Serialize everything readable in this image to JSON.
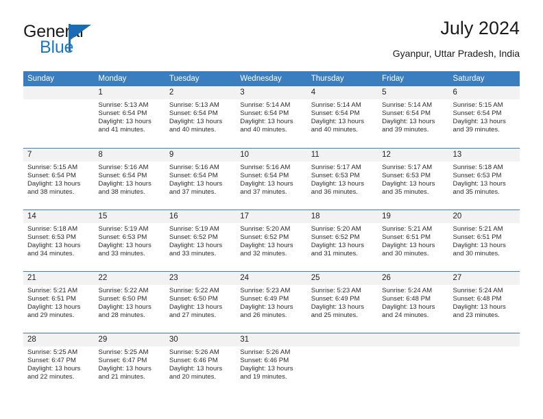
{
  "logo": {
    "word1": "General",
    "word2": "Blue",
    "accent_color": "#1c6cb5"
  },
  "header": {
    "title": "July 2024",
    "subtitle": "Gyanpur, Uttar Pradesh, India"
  },
  "theme": {
    "header_bar_color": "#3a7ebf",
    "daynum_bg": "#f2f2f2",
    "text_color": "#2b2b2b"
  },
  "weekdays": [
    "Sunday",
    "Monday",
    "Tuesday",
    "Wednesday",
    "Thursday",
    "Friday",
    "Saturday"
  ],
  "labels": {
    "sunrise_prefix": "Sunrise: ",
    "sunset_prefix": "Sunset: ",
    "daylight_prefix": "Daylight: "
  },
  "weeks": [
    [
      {
        "day": "",
        "sunrise": "",
        "sunset": "",
        "daylight_line1": "",
        "daylight_line2": ""
      },
      {
        "day": "1",
        "sunrise": "Sunrise: 5:13 AM",
        "sunset": "Sunset: 6:54 PM",
        "daylight_line1": "Daylight: 13 hours",
        "daylight_line2": "and 41 minutes."
      },
      {
        "day": "2",
        "sunrise": "Sunrise: 5:13 AM",
        "sunset": "Sunset: 6:54 PM",
        "daylight_line1": "Daylight: 13 hours",
        "daylight_line2": "and 40 minutes."
      },
      {
        "day": "3",
        "sunrise": "Sunrise: 5:14 AM",
        "sunset": "Sunset: 6:54 PM",
        "daylight_line1": "Daylight: 13 hours",
        "daylight_line2": "and 40 minutes."
      },
      {
        "day": "4",
        "sunrise": "Sunrise: 5:14 AM",
        "sunset": "Sunset: 6:54 PM",
        "daylight_line1": "Daylight: 13 hours",
        "daylight_line2": "and 40 minutes."
      },
      {
        "day": "5",
        "sunrise": "Sunrise: 5:14 AM",
        "sunset": "Sunset: 6:54 PM",
        "daylight_line1": "Daylight: 13 hours",
        "daylight_line2": "and 39 minutes."
      },
      {
        "day": "6",
        "sunrise": "Sunrise: 5:15 AM",
        "sunset": "Sunset: 6:54 PM",
        "daylight_line1": "Daylight: 13 hours",
        "daylight_line2": "and 39 minutes."
      }
    ],
    [
      {
        "day": "7",
        "sunrise": "Sunrise: 5:15 AM",
        "sunset": "Sunset: 6:54 PM",
        "daylight_line1": "Daylight: 13 hours",
        "daylight_line2": "and 38 minutes."
      },
      {
        "day": "8",
        "sunrise": "Sunrise: 5:16 AM",
        "sunset": "Sunset: 6:54 PM",
        "daylight_line1": "Daylight: 13 hours",
        "daylight_line2": "and 38 minutes."
      },
      {
        "day": "9",
        "sunrise": "Sunrise: 5:16 AM",
        "sunset": "Sunset: 6:54 PM",
        "daylight_line1": "Daylight: 13 hours",
        "daylight_line2": "and 37 minutes."
      },
      {
        "day": "10",
        "sunrise": "Sunrise: 5:16 AM",
        "sunset": "Sunset: 6:54 PM",
        "daylight_line1": "Daylight: 13 hours",
        "daylight_line2": "and 37 minutes."
      },
      {
        "day": "11",
        "sunrise": "Sunrise: 5:17 AM",
        "sunset": "Sunset: 6:53 PM",
        "daylight_line1": "Daylight: 13 hours",
        "daylight_line2": "and 36 minutes."
      },
      {
        "day": "12",
        "sunrise": "Sunrise: 5:17 AM",
        "sunset": "Sunset: 6:53 PM",
        "daylight_line1": "Daylight: 13 hours",
        "daylight_line2": "and 35 minutes."
      },
      {
        "day": "13",
        "sunrise": "Sunrise: 5:18 AM",
        "sunset": "Sunset: 6:53 PM",
        "daylight_line1": "Daylight: 13 hours",
        "daylight_line2": "and 35 minutes."
      }
    ],
    [
      {
        "day": "14",
        "sunrise": "Sunrise: 5:18 AM",
        "sunset": "Sunset: 6:53 PM",
        "daylight_line1": "Daylight: 13 hours",
        "daylight_line2": "and 34 minutes."
      },
      {
        "day": "15",
        "sunrise": "Sunrise: 5:19 AM",
        "sunset": "Sunset: 6:53 PM",
        "daylight_line1": "Daylight: 13 hours",
        "daylight_line2": "and 33 minutes."
      },
      {
        "day": "16",
        "sunrise": "Sunrise: 5:19 AM",
        "sunset": "Sunset: 6:52 PM",
        "daylight_line1": "Daylight: 13 hours",
        "daylight_line2": "and 33 minutes."
      },
      {
        "day": "17",
        "sunrise": "Sunrise: 5:20 AM",
        "sunset": "Sunset: 6:52 PM",
        "daylight_line1": "Daylight: 13 hours",
        "daylight_line2": "and 32 minutes."
      },
      {
        "day": "18",
        "sunrise": "Sunrise: 5:20 AM",
        "sunset": "Sunset: 6:52 PM",
        "daylight_line1": "Daylight: 13 hours",
        "daylight_line2": "and 31 minutes."
      },
      {
        "day": "19",
        "sunrise": "Sunrise: 5:21 AM",
        "sunset": "Sunset: 6:51 PM",
        "daylight_line1": "Daylight: 13 hours",
        "daylight_line2": "and 30 minutes."
      },
      {
        "day": "20",
        "sunrise": "Sunrise: 5:21 AM",
        "sunset": "Sunset: 6:51 PM",
        "daylight_line1": "Daylight: 13 hours",
        "daylight_line2": "and 30 minutes."
      }
    ],
    [
      {
        "day": "21",
        "sunrise": "Sunrise: 5:21 AM",
        "sunset": "Sunset: 6:51 PM",
        "daylight_line1": "Daylight: 13 hours",
        "daylight_line2": "and 29 minutes."
      },
      {
        "day": "22",
        "sunrise": "Sunrise: 5:22 AM",
        "sunset": "Sunset: 6:50 PM",
        "daylight_line1": "Daylight: 13 hours",
        "daylight_line2": "and 28 minutes."
      },
      {
        "day": "23",
        "sunrise": "Sunrise: 5:22 AM",
        "sunset": "Sunset: 6:50 PM",
        "daylight_line1": "Daylight: 13 hours",
        "daylight_line2": "and 27 minutes."
      },
      {
        "day": "24",
        "sunrise": "Sunrise: 5:23 AM",
        "sunset": "Sunset: 6:49 PM",
        "daylight_line1": "Daylight: 13 hours",
        "daylight_line2": "and 26 minutes."
      },
      {
        "day": "25",
        "sunrise": "Sunrise: 5:23 AM",
        "sunset": "Sunset: 6:49 PM",
        "daylight_line1": "Daylight: 13 hours",
        "daylight_line2": "and 25 minutes."
      },
      {
        "day": "26",
        "sunrise": "Sunrise: 5:24 AM",
        "sunset": "Sunset: 6:48 PM",
        "daylight_line1": "Daylight: 13 hours",
        "daylight_line2": "and 24 minutes."
      },
      {
        "day": "27",
        "sunrise": "Sunrise: 5:24 AM",
        "sunset": "Sunset: 6:48 PM",
        "daylight_line1": "Daylight: 13 hours",
        "daylight_line2": "and 23 minutes."
      }
    ],
    [
      {
        "day": "28",
        "sunrise": "Sunrise: 5:25 AM",
        "sunset": "Sunset: 6:47 PM",
        "daylight_line1": "Daylight: 13 hours",
        "daylight_line2": "and 22 minutes."
      },
      {
        "day": "29",
        "sunrise": "Sunrise: 5:25 AM",
        "sunset": "Sunset: 6:47 PM",
        "daylight_line1": "Daylight: 13 hours",
        "daylight_line2": "and 21 minutes."
      },
      {
        "day": "30",
        "sunrise": "Sunrise: 5:26 AM",
        "sunset": "Sunset: 6:46 PM",
        "daylight_line1": "Daylight: 13 hours",
        "daylight_line2": "and 20 minutes."
      },
      {
        "day": "31",
        "sunrise": "Sunrise: 5:26 AM",
        "sunset": "Sunset: 6:46 PM",
        "daylight_line1": "Daylight: 13 hours",
        "daylight_line2": "and 19 minutes."
      },
      {
        "day": "",
        "sunrise": "",
        "sunset": "",
        "daylight_line1": "",
        "daylight_line2": ""
      },
      {
        "day": "",
        "sunrise": "",
        "sunset": "",
        "daylight_line1": "",
        "daylight_line2": ""
      },
      {
        "day": "",
        "sunrise": "",
        "sunset": "",
        "daylight_line1": "",
        "daylight_line2": ""
      }
    ]
  ]
}
